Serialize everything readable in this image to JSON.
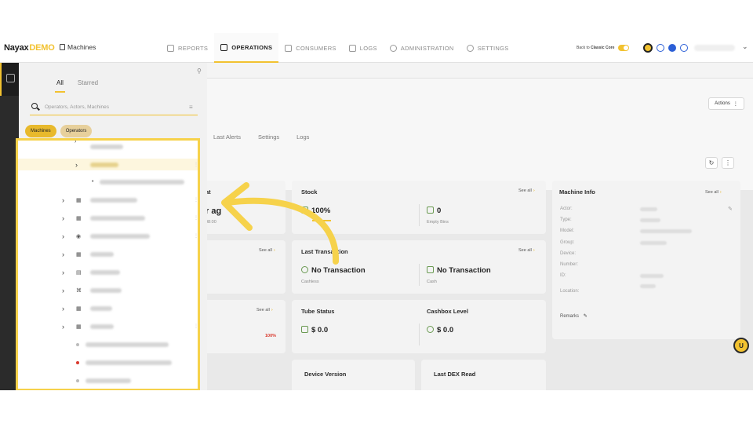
{
  "app": {
    "logo_main": "Nayax",
    "logo_demo": "DEMO",
    "breadcrumb": "Machines"
  },
  "nav": {
    "items": [
      {
        "label": "REPORTS",
        "active": false
      },
      {
        "label": "OPERATIONS",
        "active": true
      },
      {
        "label": "CONSUMERS",
        "active": false
      },
      {
        "label": "LOGS",
        "active": false
      },
      {
        "label": "ADMINISTRATION",
        "active": false
      },
      {
        "label": "SETTINGS",
        "active": false
      }
    ],
    "back_to_prefix": "Back to",
    "back_to_brand": "Classic Core"
  },
  "tree_panel": {
    "tab_all": "All",
    "tab_starred": "Starred",
    "search_placeholder": "Operators, Actors, Machines",
    "chip_machines": "Machines",
    "chip_operators": "Operators"
  },
  "page": {
    "actions_label": "Actions",
    "tabs": [
      "Last Alerts",
      "Settings",
      "Logs"
    ]
  },
  "cards": {
    "partial_title": "at",
    "partial_value": "r ag",
    "partial_sub": "08:00",
    "partial_see_all": "See all",
    "partial_see_all_2": "See all",
    "partial_percent": "100%",
    "stock": {
      "title": "Stock",
      "see_all": "See all",
      "value_left": "100%",
      "value_right": "0",
      "sub_right": "Empty Bins"
    },
    "last_transaction": {
      "title": "Last Transaction",
      "see_all": "See all",
      "left_value": "No Transaction",
      "left_sub": "Cashless",
      "right_value": "No Transaction",
      "right_sub": "Cash"
    },
    "tube_status": {
      "title": "Tube Status",
      "value": "$ 0.0"
    },
    "cashbox_level": {
      "title": "Cashbox Level",
      "value": "$ 0.0"
    },
    "device_version": {
      "title": "Device Version"
    },
    "last_dex_read": {
      "title": "Last DEX Read"
    },
    "machine_info": {
      "title": "Machine Info",
      "see_all": "See all",
      "fields": [
        "Actor:",
        "Type:",
        "Model:",
        "Group:",
        "Device:",
        "Number:",
        "ID:",
        "Location:"
      ],
      "remarks": "Remarks"
    }
  },
  "colors": {
    "accent": "#f2c230",
    "highlight_border": "#f6d24b",
    "dark_rail": "#2b2b2b"
  }
}
